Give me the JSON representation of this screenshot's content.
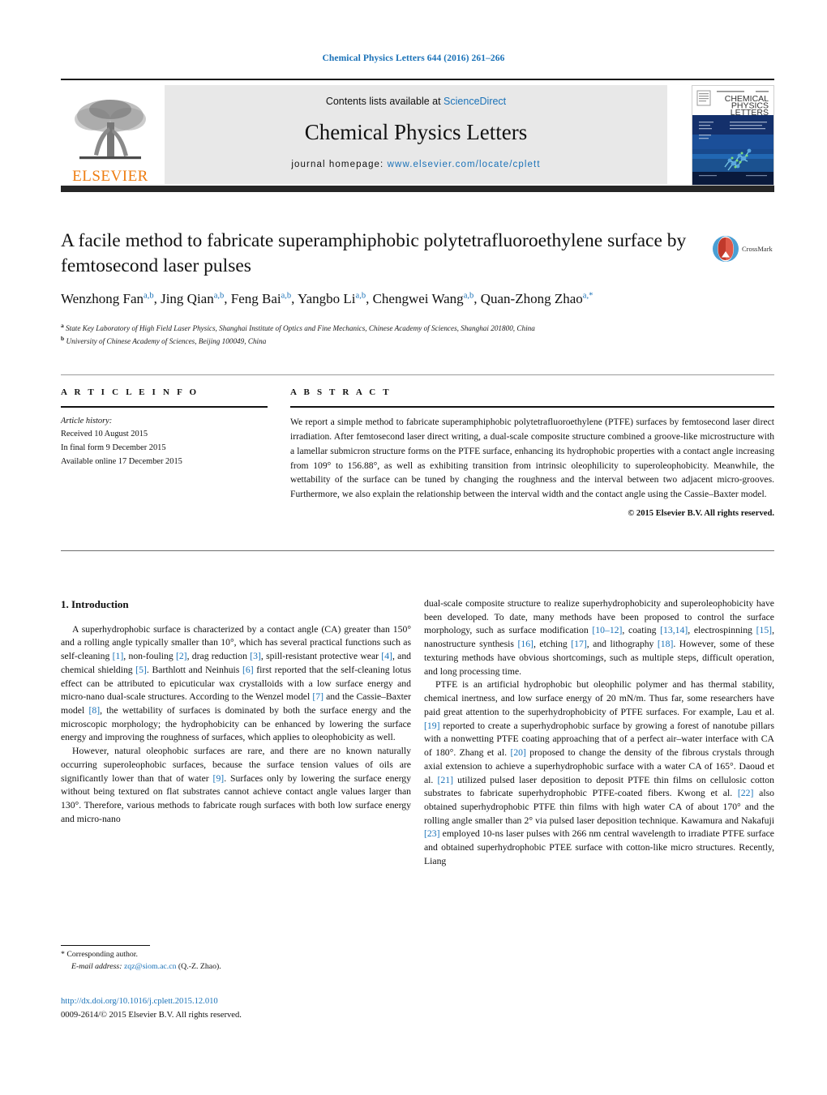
{
  "running_head": "Chemical Physics Letters 644 (2016) 261–266",
  "masthead": {
    "elsevier_wordmark": "ELSEVIER",
    "contents_prefix": "Contents lists available at ",
    "contents_link": "ScienceDirect",
    "journal_title": "Chemical Physics Letters",
    "homepage_prefix": "journal homepage: ",
    "homepage_url": "www.elsevier.com/locate/cplett",
    "cover_title_line1": "CHEMICAL",
    "cover_title_line2": "PHYSICS",
    "cover_title_line3": "LETTERS"
  },
  "article": {
    "title": "A facile method to fabricate superamphiphobic polytetrafluoroethylene surface by femtosecond laser pulses",
    "authors_html": "Wenzhong Fan<sup>a,b</sup>, Jing Qian<sup>a,b</sup>, Feng Bai<sup>a,b</sup>, Yangbo Li<sup>a,b</sup>, Chengwei Wang<sup>a,b</sup>, Quan-Zhong Zhao<sup>a,*</sup>",
    "affiliation_a": "State Key Laboratory of High Field Laser Physics, Shanghai Institute of Optics and Fine Mechanics, Chinese Academy of Sciences, Shanghai 201800, China",
    "affiliation_b": "University of Chinese Academy of Sciences, Beijing 100049, China",
    "crossmark_label": "CrossMark"
  },
  "info": {
    "heading": "A R T I C L E   I N F O",
    "history_label": "Article history:",
    "received": "Received 10 August 2015",
    "final_form": "In final form 9 December 2015",
    "available": "Available online 17 December 2015"
  },
  "abstract": {
    "heading": "A B S T R A C T",
    "text": "We report a simple method to fabricate superamphiphobic polytetrafluoroethylene (PTFE) surfaces by femtosecond laser direct irradiation. After femtosecond laser direct writing, a dual-scale composite structure combined a groove-like microstructure with a lamellar submicron structure forms on the PTFE surface, enhancing its hydrophobic properties with a contact angle increasing from 109° to 156.88°, as well as exhibiting transition from intrinsic oleophilicity to superoleophobicity. Meanwhile, the wettability of the surface can be tuned by changing the roughness and the interval between two adjacent micro-grooves. Furthermore, we also explain the relationship between the interval width and the contact angle using the Cassie–Baxter model.",
    "copyright": "© 2015 Elsevier B.V. All rights reserved."
  },
  "body": {
    "section_number_title": "1.  Introduction",
    "left_paragraph_1": "A superhydrophobic surface is characterized by a contact angle (CA) greater than 150° and a rolling angle typically smaller than 10°, which has several practical functions such as self-cleaning [1], non-fouling [2], drag reduction [3], spill-resistant protective wear [4], and chemical shielding [5]. Barthlott and Neinhuis [6] first reported that the self-cleaning lotus effect can be attributed to epicuticular wax crystalloids with a low surface energy and micro-nano dual-scale structures. According to the Wenzel model [7] and the Cassie–Baxter model [8], the wettability of surfaces is dominated by both the surface energy and the microscopic morphology; the hydrophobicity can be enhanced by lowering the surface energy and improving the roughness of surfaces, which applies to oleophobicity as well.",
    "left_paragraph_2": "However, natural oleophobic surfaces are rare, and there are no known naturally occurring superoleophobic surfaces, because the surface tension values of oils are significantly lower than that of water [9]. Surfaces only by lowering the surface energy without being textured on flat substrates cannot achieve contact angle values larger than 130°. Therefore, various methods to fabricate rough surfaces with both low surface energy and micro-nano",
    "right_paragraph_1": "dual-scale composite structure to realize superhydrophobicity and superoleophobicity have been developed. To date, many methods have been proposed to control the surface morphology, such as surface modification [10–12], coating [13,14], electrospinning [15], nanostructure synthesis [16], etching [17], and lithography [18]. However, some of these texturing methods have obvious shortcomings, such as multiple steps, difficult operation, and long processing time.",
    "right_paragraph_2": "PTFE is an artificial hydrophobic but oleophilic polymer and has thermal stability, chemical inertness, and low surface energy of 20 mN/m. Thus far, some researchers have paid great attention to the superhydrophobicity of PTFE surfaces. For example, Lau et al. [19] reported to create a superhydrophobic surface by growing a forest of nanotube pillars with a nonwetting PTFE coating approaching that of a perfect air–water interface with CA of 180°. Zhang et al. [20] proposed to change the density of the fibrous crystals through axial extension to achieve a superhydrophobic surface with a water CA of 165°. Daoud et al. [21] utilized pulsed laser deposition to deposit PTFE thin films on cellulosic cotton substrates to fabricate superhydrophobic PTFE-coated fibers. Kwong et al. [22] also obtained superhydrophobic PTFE thin films with high water CA of about 170° and the rolling angle smaller than 2° via pulsed laser deposition technique. Kawamura and Nakafuji [23] employed 10-ns laser pulses with 266 nm central wavelength to irradiate PTFE surface and obtained superhydrophobic PTEE surface with cotton-like micro structures. Recently, Liang"
  },
  "footer": {
    "corresponding_marker": "*",
    "corresponding_author": "Corresponding author.",
    "email_label": "E-mail address:",
    "email": "zqz@siom.ac.cn",
    "email_suffix": "(Q.-Z. Zhao).",
    "doi_url": "http://dx.doi.org/10.1016/j.cplett.2015.12.010",
    "issn_line": "0009-2614/© 2015 Elsevier B.V. All rights reserved."
  },
  "colors": {
    "link_blue": "#1a72b8",
    "elsevier_orange": "#ee7d11",
    "rule_dark": "#262626"
  }
}
